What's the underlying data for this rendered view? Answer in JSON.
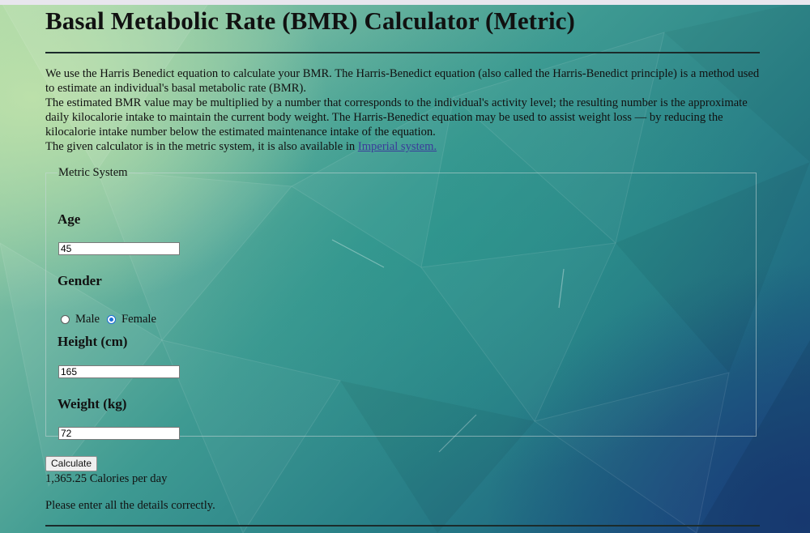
{
  "page": {
    "title": "Basal Metabolic Rate (BMR) Calculator (Metric)"
  },
  "intro": {
    "p1": "We use the Harris Benedict equation to calculate your BMR. The Harris-Benedict equation (also called the Harris-Benedict principle) is a method used to estimate an individual's basal metabolic rate (BMR).",
    "p2": "The estimated BMR value may be multiplied by a number that corresponds to the individual's activity level; the resulting number is the approximate daily kilocalorie intake to maintain the current body weight. The Harris-Benedict equation may be used to assist weight loss — by reducing the kilocalorie intake number below the estimated maintenance intake of the equation.",
    "p3_prefix": "The given calculator is in the metric system, it is also available in ",
    "imperial_link": "Imperial system."
  },
  "form": {
    "legend": "Metric System",
    "age_label": "Age",
    "age_value": "45",
    "gender_label": "Gender",
    "gender_options": [
      "Male",
      "Female"
    ],
    "gender_selected": "Female",
    "height_label": "Height (cm)",
    "height_value": "165",
    "weight_label": "Weight (kg)",
    "weight_value": "72"
  },
  "actions": {
    "calculate_label": "Calculate"
  },
  "output": {
    "result": "1,365.25 Calories per day",
    "error": "Please enter all the details correctly."
  },
  "colors": {
    "accent_radio": "#1d6fd6",
    "link": "#3b3b9a",
    "rule": "#1b2b2b"
  }
}
